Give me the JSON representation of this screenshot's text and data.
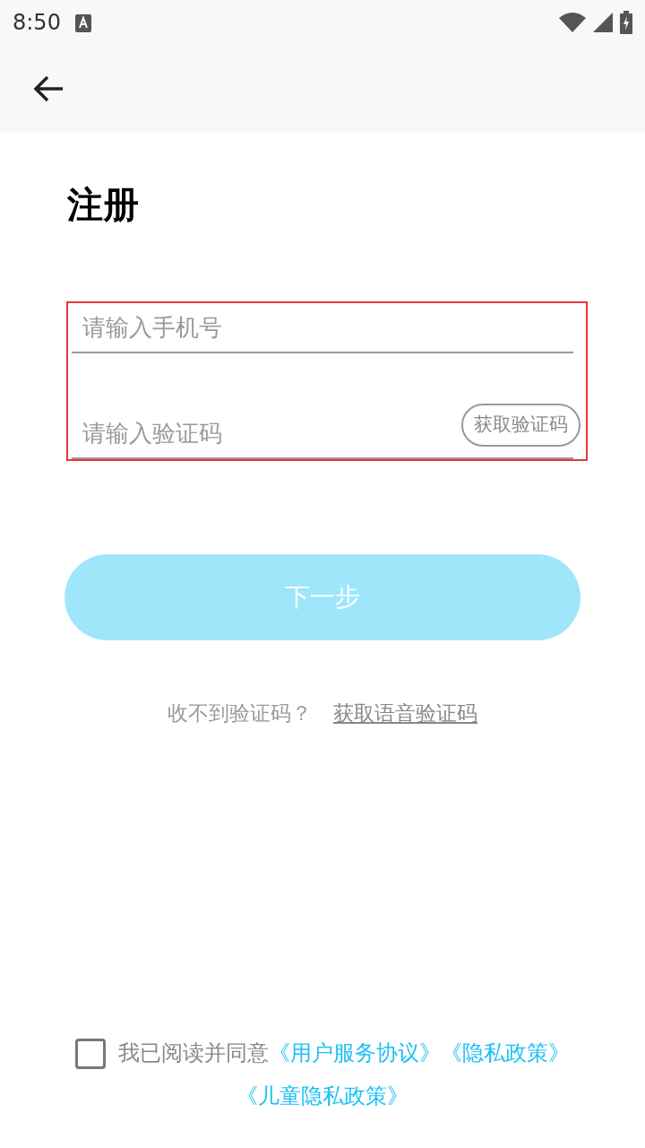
{
  "status_bar": {
    "time": "8:50"
  },
  "title": "注册",
  "form": {
    "highlighted": true,
    "fields": [
      {
        "placeholder": "请输入手机号"
      },
      {
        "placeholder": "请输入验证码",
        "button": "获取验证码"
      }
    ]
  },
  "next_button": {
    "label": "下一步",
    "disabled": true
  },
  "help": {
    "text": "收不到验证码？",
    "link": "获取语音验证码"
  },
  "agreement": {
    "checked": false,
    "text": "我已阅读并同意",
    "links": [
      "《用户服务协议》",
      "《隐私政策》",
      "《儿童隐私政策》"
    ]
  }
}
